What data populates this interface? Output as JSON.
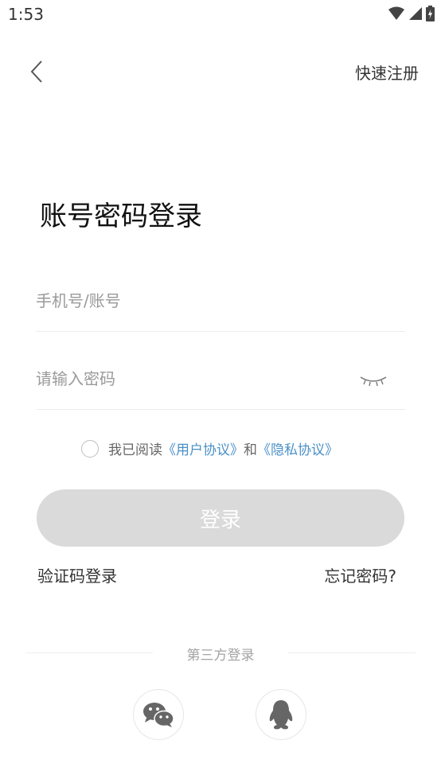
{
  "status_bar": {
    "time": "1:53"
  },
  "header": {
    "register_label": "快速注册"
  },
  "title": "账号密码登录",
  "form": {
    "account_placeholder": "手机号/账号",
    "password_placeholder": "请输入密码"
  },
  "agreement": {
    "prefix": "我已阅读",
    "user_agreement": "《用户协议》",
    "and": "和",
    "privacy_agreement": "《隐私协议》"
  },
  "login_label": "登录",
  "sms_login_label": "验证码登录",
  "forgot_label": "忘记密码?",
  "third_party": {
    "label": "第三方登录"
  },
  "colors": {
    "link": "#4a90c8",
    "button_disabled": "#dadada"
  },
  "icons": [
    "back-icon",
    "eye-closed-icon",
    "wechat-icon",
    "qq-icon",
    "wifi-icon",
    "signal-icon",
    "battery-icon"
  ]
}
